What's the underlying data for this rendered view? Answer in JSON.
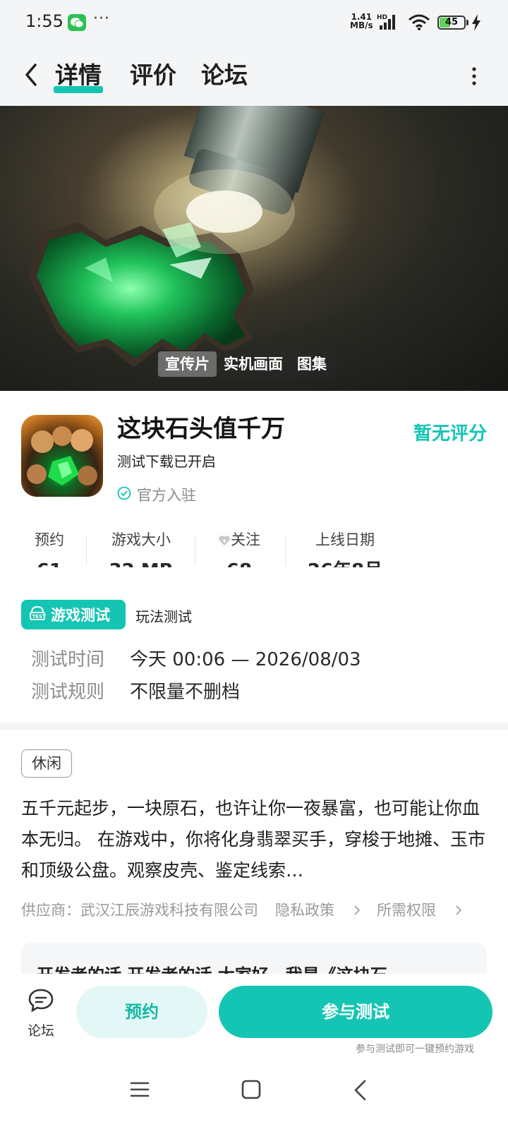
{
  "status_bar": {
    "time": "1:55",
    "more": "···",
    "net_speed_value": "1.41",
    "net_speed_unit": "MB/s",
    "hd_label": "HD",
    "battery_level": "45",
    "battery_fraction": 0.45
  },
  "nav": {
    "tabs": [
      {
        "label": "详情"
      },
      {
        "label": "评价"
      },
      {
        "label": "论坛"
      }
    ]
  },
  "banner": {
    "media_tabs": [
      {
        "label": "宣传片"
      },
      {
        "label": "实机画面"
      },
      {
        "label": "图集"
      }
    ]
  },
  "app": {
    "title": "这块石头值千万",
    "subtitle": "测试下载已开启",
    "official": "官方入驻",
    "rating": "暂无评分"
  },
  "stats": [
    {
      "label": "预约",
      "value": "61"
    },
    {
      "label": "游戏大小",
      "value": "32 MB"
    },
    {
      "label": "关注",
      "value": "68"
    },
    {
      "label": "上线日期",
      "value": "26年8月"
    }
  ],
  "test": {
    "badge": "游戏测试",
    "type": "玩法测试",
    "time_label": "测试时间",
    "time_value": "今天 00:06 — 2026/08/03",
    "rule_label": "测试规则",
    "rule_value": "不限量不删档"
  },
  "description": {
    "tag": "休闲",
    "text": "五千元起步，一块原石，也许让你一夜暴富，也可能让你血本无归。 在游戏中，你将化身翡翠买手，穿梭于地摊、玉市和顶级公盘。观察皮壳、鉴定线索…",
    "supplier": "供应商：武汉江辰游戏科技有限公司",
    "privacy": "隐私政策",
    "permissions": "所需权限"
  },
  "dev_card": {
    "text": "开发者的话  开发者的话 大家好，我是《这块石"
  },
  "actions": {
    "forum": "论坛",
    "reserve": "预约",
    "join": "参与测试",
    "join_hint": "参与测试即可一键预约游戏"
  },
  "colors": {
    "accent": "#15c5b3",
    "accent_light": "#e3f8f6"
  }
}
